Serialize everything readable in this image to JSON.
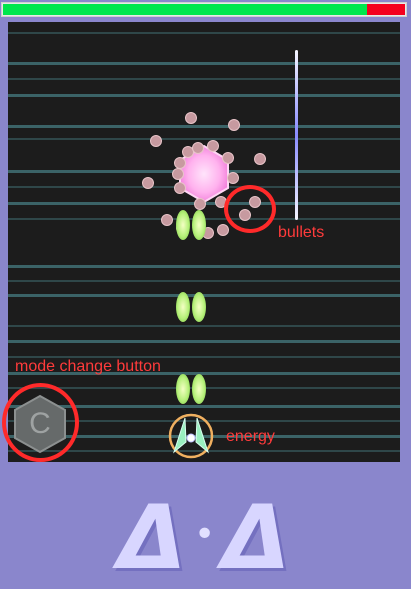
{
  "hp": {
    "fraction": 0.906,
    "fill_color": "#00e64d",
    "empty_color": "#f5001e"
  },
  "labels": {
    "bullets": "bullets",
    "mode_change": "mode change button",
    "energy": "energy"
  },
  "mode_button": {
    "letter": "C"
  },
  "logo": {
    "left": "Δ",
    "dot": "•",
    "right": "Δ"
  },
  "colors": {
    "background": "#8a86cc",
    "playfield": "#1c1c1c",
    "annotation": "#ff2a2a",
    "boss": "#ffb2ee",
    "bullet": "#c79aa0",
    "shot": "#b6f07a"
  },
  "icons": {
    "boss": "hexagon-enemy-icon",
    "player": "triangle-ship-icon",
    "mode_button": "hexagon-button-icon"
  }
}
